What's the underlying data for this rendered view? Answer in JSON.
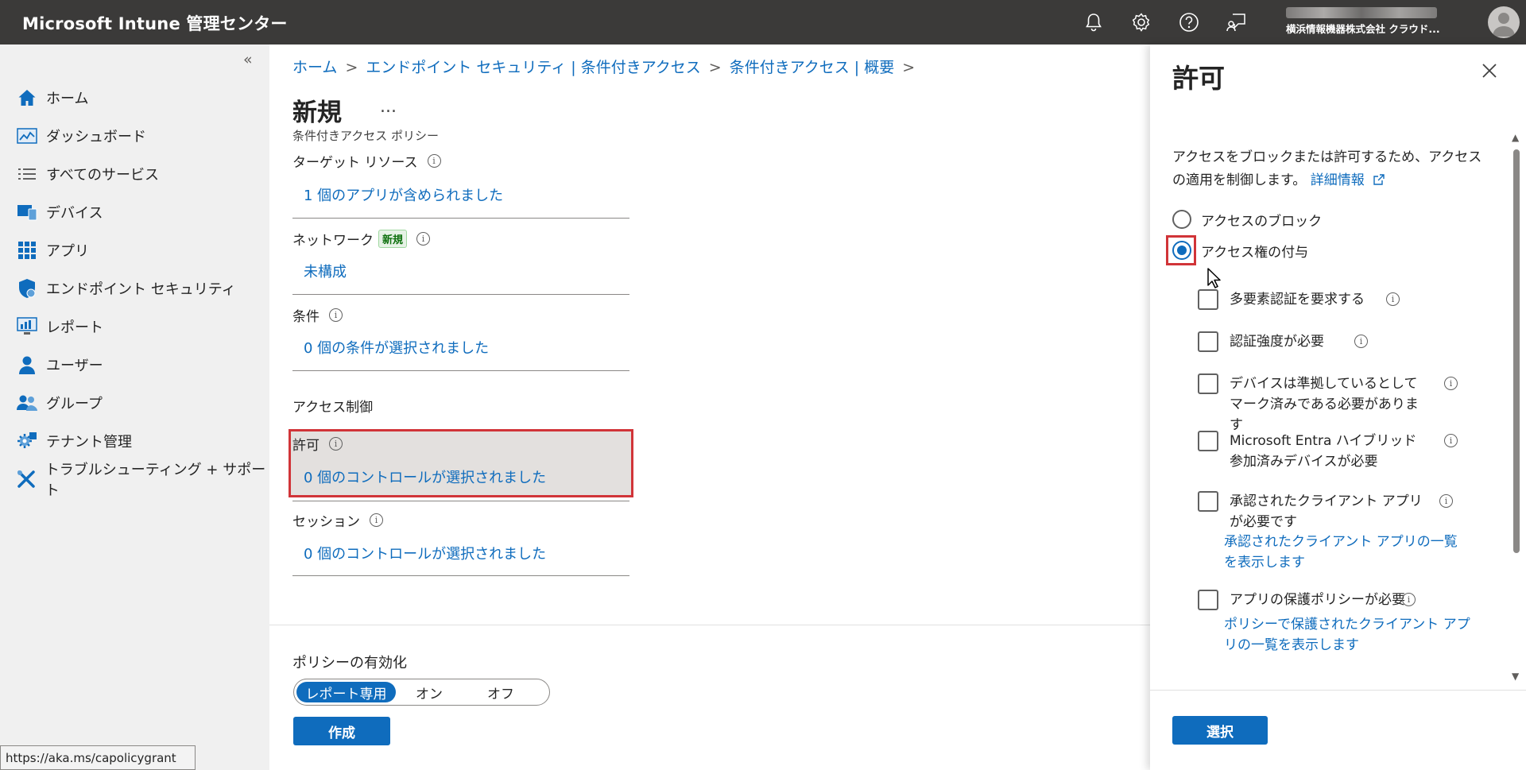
{
  "topbar": {
    "title": "Microsoft Intune 管理センター",
    "account_org": "横浜情報機器株式会社 クラウド..."
  },
  "sidebar": {
    "collapse": "«",
    "items": [
      {
        "label": "ホーム",
        "icon": "home-icon"
      },
      {
        "label": "ダッシュボード",
        "icon": "dashboard-icon"
      },
      {
        "label": "すべてのサービス",
        "icon": "list-icon"
      },
      {
        "label": "デバイス",
        "icon": "device-icon"
      },
      {
        "label": "アプリ",
        "icon": "apps-grid-icon"
      },
      {
        "label": "エンドポイント セキュリティ",
        "icon": "shield-icon"
      },
      {
        "label": "レポート",
        "icon": "report-icon"
      },
      {
        "label": "ユーザー",
        "icon": "user-icon"
      },
      {
        "label": "グループ",
        "icon": "group-icon"
      },
      {
        "label": "テナント管理",
        "icon": "tenant-gear-icon"
      },
      {
        "label": "トラブルシューティング + サポート",
        "icon": "wrench-icon"
      }
    ]
  },
  "breadcrumb": [
    "ホーム",
    "エンドポイント セキュリティ | 条件付きアクセス",
    "条件付きアクセス | 概要"
  ],
  "page": {
    "title": "新規",
    "more": "...",
    "subtitle": "条件付きアクセス ポリシー",
    "target_label": "ターゲット リソース",
    "target_value": "1 個のアプリが含められました",
    "network_label": "ネットワーク",
    "network_badge": "新規",
    "network_value": "未構成",
    "conditions_label": "条件",
    "conditions_value": "0 個の条件が選択されました",
    "access_control_label": "アクセス制御",
    "grant_label": "許可",
    "grant_value": "0 個のコントロールが選択されました",
    "session_label": "セッション",
    "session_value": "0 個のコントロールが選択されました",
    "policy_enable_label": "ポリシーの有効化",
    "policy_options": [
      "レポート専用",
      "オン",
      "オフ"
    ],
    "policy_selected": "レポート専用",
    "create_button": "作成"
  },
  "status_url": "https://aka.ms/capolicygrant",
  "panel": {
    "title": "許可",
    "description": "アクセスをブロックまたは許可するため、アクセスの適用を制御します。",
    "learn_more": "詳細情報",
    "radio_block": "アクセスのブロック",
    "radio_grant": "アクセス権の付与",
    "selected": "アクセス権の付与",
    "checkboxes": [
      {
        "label": "多要素認証を要求する",
        "checked": false
      },
      {
        "label": "認証強度が必要",
        "checked": false
      },
      {
        "label": "デバイスは準拠しているとしてマーク済みである必要があります",
        "checked": false
      },
      {
        "label": "Microsoft Entra ハイブリッド参加済みデバイスが必要",
        "checked": false
      },
      {
        "label": "承認されたクライアント アプリが必要です",
        "checked": false,
        "link": "承認されたクライアント アプリの一覧を表示します"
      },
      {
        "label": "アプリの保護ポリシーが必要",
        "checked": false,
        "link": "ポリシーで保護されたクライアント アプリの一覧を表示します"
      }
    ],
    "select_button": "選択"
  },
  "colors": {
    "accent": "#0f6cbd",
    "highlight": "#d13438",
    "topbar": "#3b3a39"
  }
}
